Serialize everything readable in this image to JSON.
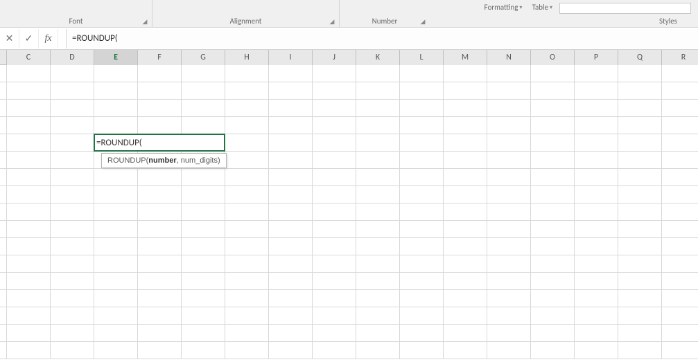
{
  "ribbon": {
    "groups": {
      "font": "Font",
      "alignment": "Alignment",
      "number": "Number",
      "styles": "Styles"
    },
    "buttons": {
      "formatting": "Formatting",
      "table": "Table"
    }
  },
  "formula_bar": {
    "cancel": "✕",
    "enter": "✓",
    "fx": "fx",
    "value": "=ROUNDUP("
  },
  "grid": {
    "columns": [
      "C",
      "D",
      "E",
      "F",
      "G",
      "H",
      "I",
      "J",
      "K",
      "L",
      "M",
      "N",
      "O",
      "P",
      "Q",
      "R"
    ],
    "active_column": "E",
    "row_count": 17,
    "active_cell": {
      "col_index": 2,
      "row_index": 4,
      "text": "=ROUNDUP("
    }
  },
  "tooltip": {
    "func": "ROUNDUP",
    "arg_bold": "number",
    "rest": ", num_digits)"
  }
}
